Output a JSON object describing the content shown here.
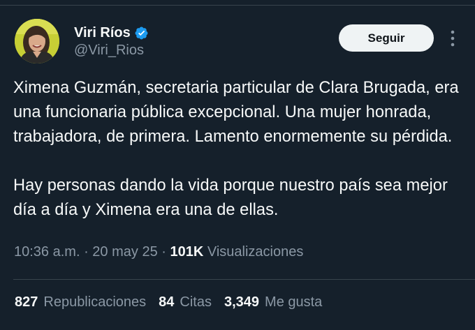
{
  "author": {
    "name": "Viri Ríos",
    "handle": "@Viri_Rios",
    "verified": true,
    "verified_color": "#1d9bf0"
  },
  "follow_label": "Seguir",
  "more_icon": "more-dots-icon",
  "text": {
    "paragraph1": "Ximena Guzmán, secretaria particular de Clara Brugada, era una funcionaria pública excepcional. Una mujer honrada, trabajadora, de primera. Lamento enormemente su pérdida.",
    "paragraph2": "Hay personas dando la vida porque nuestro país sea mejor día a día y Ximena era una de ellas."
  },
  "meta": {
    "time": "10:36 a.m.",
    "separator": " · ",
    "date": "20 may 25",
    "views_count": "101K",
    "views_label": "Visualizaciones"
  },
  "stats": {
    "reposts_count": "827",
    "reposts_label": "Republicaciones",
    "quotes_count": "84",
    "quotes_label": "Citas",
    "likes_count": "3,349",
    "likes_label": "Me gusta"
  },
  "colors": {
    "background": "#15202b",
    "text": "#f7f9f9",
    "secondary_text": "#8b98a5",
    "divider": "#38444d",
    "button_bg": "#eff3f4"
  }
}
